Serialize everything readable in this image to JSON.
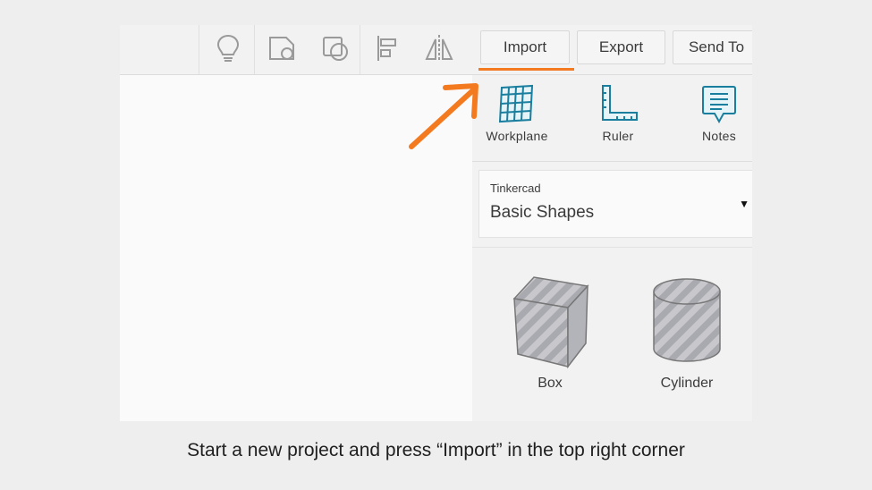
{
  "toolbar": {
    "icons": [
      "lightbulb-icon",
      "shape-notes-icon",
      "group-icon",
      "align-icon",
      "mirror-icon"
    ],
    "tabs": [
      {
        "label": "Import"
      },
      {
        "label": "Export"
      },
      {
        "label": "Send To"
      }
    ],
    "active_tab": "Import",
    "accent_color": "#f47a1f"
  },
  "panel": {
    "tools": [
      {
        "label": "Workplane",
        "icon": "workplane-grid-icon"
      },
      {
        "label": "Ruler",
        "icon": "ruler-icon"
      },
      {
        "label": "Notes",
        "icon": "notes-icon"
      }
    ],
    "library": {
      "source": "Tinkercad",
      "selected": "Basic Shapes"
    },
    "shapes": [
      {
        "label": "Box",
        "icon": "box-shape-icon"
      },
      {
        "label": "Cylinder",
        "icon": "cylinder-shape-icon"
      }
    ]
  },
  "caption": "Start a new project and press “Import” in the top right corner",
  "colors": {
    "icon_teal": "#1a7f9e",
    "arrow_orange": "#f47a1f"
  }
}
